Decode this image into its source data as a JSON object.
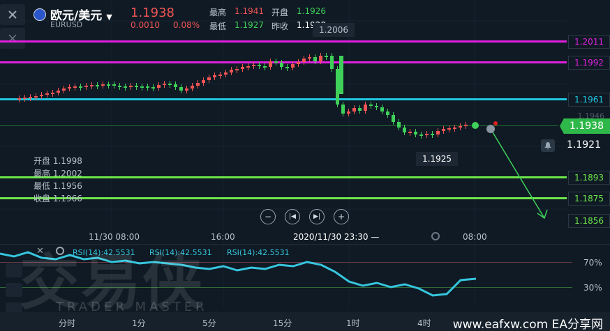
{
  "header": {
    "pair_title": "欧元/美元",
    "pair_code": "EURUSD",
    "price": "1.1938",
    "change": "0.0010",
    "change_pct": "0.08%",
    "high_label": "最高",
    "high_value": "1.1941",
    "open_label": "开盘",
    "open_value": "1.1926",
    "low_label": "最低",
    "low_value": "1.1927",
    "prev_label": "昨收",
    "prev_value": "1.1928"
  },
  "chart": {
    "peak_label": "1.2006",
    "low_marker": "1.1925",
    "faint_label": "1.1946",
    "current_price": "1.1938",
    "alert_price": "1.1921",
    "levels": [
      {
        "price": "1.2011",
        "color": "#e020e0"
      },
      {
        "price": "1.1992",
        "color": "#e020e0"
      },
      {
        "price": "1.1961",
        "color": "#20c8e0"
      },
      {
        "price": "1.1893",
        "color": "#6ee64a"
      },
      {
        "price": "1.1875",
        "color": "#6ee64a"
      },
      {
        "price": "1.1856",
        "color": "#6ee64a"
      }
    ],
    "ohlc": {
      "open_label": "开盘",
      "open": "1.1998",
      "high_label": "最高",
      "high": "1.2002",
      "low_label": "最低",
      "low": "1.1956",
      "close_label": "收盘",
      "close": "1.1966"
    },
    "time_labels": [
      "11/30 08:00",
      "16:00",
      "2020/11/30 23:30 —",
      "08:00"
    ],
    "rsi_labels": [
      "RSI(14):42.5531",
      "RSI(14):42.5531",
      "RSI(14):42.5531"
    ],
    "rsi_levels": [
      "70%",
      "30%"
    ],
    "timeframes": [
      "分时",
      "1分",
      "5分",
      "15分",
      "1时",
      "4时"
    ]
  },
  "watermark": {
    "big": "交易侠",
    "small": "TRADER MASTER"
  },
  "footer": {
    "site": "www.eafxw.com EA分享网"
  },
  "colors": {
    "up": "#f05454",
    "down": "#3fd05a",
    "rsi": "#36c6dd",
    "current": "#2fb84a"
  }
}
